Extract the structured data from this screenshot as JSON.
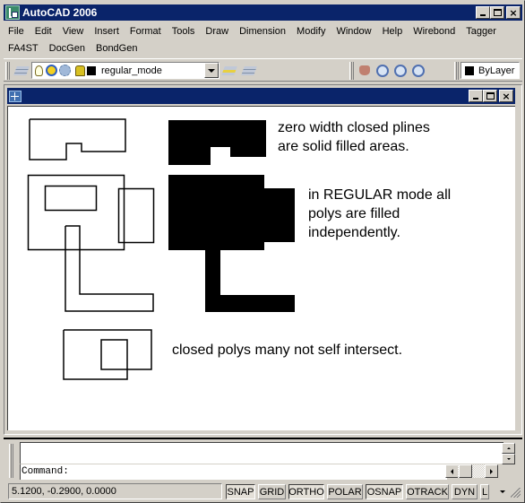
{
  "app": {
    "title": "AutoCAD 2006",
    "accent_color": "#0a246a"
  },
  "window_controls": {
    "minimize": "minimize",
    "maximize": "maximize",
    "close": "×"
  },
  "menubar": {
    "row1": [
      "File",
      "Edit",
      "View",
      "Insert",
      "Format",
      "Tools",
      "Draw",
      "Dimension",
      "Modify",
      "Window",
      "Help",
      "Wirebond",
      "Tagger"
    ],
    "row2": [
      "FA4ST",
      "DocGen",
      "BondGen"
    ]
  },
  "toolbar": {
    "layer_combo_value": "regular_mode",
    "color_combo_value": "ByLayer",
    "icons": [
      "layer-manager-icon",
      "layer-on-icon",
      "layer-thaw-icon",
      "layer-freeze-viewport-icon",
      "layer-lock-icon",
      "make-object-layer-current-icon",
      "layer-previous-icon",
      "pan-realtime-icon",
      "zoom-realtime-icon",
      "zoom-window-icon",
      "zoom-previous-icon"
    ]
  },
  "drawing": {
    "notes": [
      "zero width closed plines\nare solid filled areas.",
      "in REGULAR mode all\npolys are filled\nindependently.",
      "closed polys many not self intersect."
    ]
  },
  "command": {
    "history": "",
    "prompt": "Command:"
  },
  "statusbar": {
    "coordinates": "5.1200, -0.2900, 0.0000",
    "toggles": [
      {
        "label": "SNAP",
        "on": true
      },
      {
        "label": "GRID",
        "on": false
      },
      {
        "label": "ORTHO",
        "on": true
      },
      {
        "label": "POLAR",
        "on": false
      },
      {
        "label": "OSNAP",
        "on": true
      },
      {
        "label": "OTRACK",
        "on": false
      },
      {
        "label": "DYN",
        "on": false
      },
      {
        "label": "L",
        "on": false
      }
    ]
  }
}
